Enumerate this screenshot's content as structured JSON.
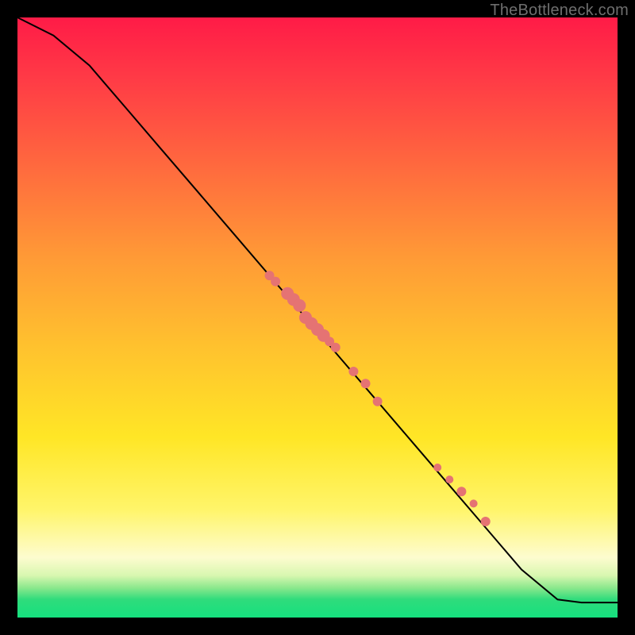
{
  "watermark": "TheBottleneck.com",
  "chart_data": {
    "type": "line",
    "title": "",
    "xlabel": "",
    "ylabel": "",
    "xlim": [
      0,
      100
    ],
    "ylim": [
      0,
      100
    ],
    "series": [
      {
        "name": "curve",
        "x": [
          0,
          6,
          12,
          18,
          24,
          30,
          36,
          42,
          48,
          54,
          60,
          66,
          72,
          78,
          84,
          90,
          94,
          100
        ],
        "y": [
          100,
          97,
          92,
          85,
          78,
          71,
          64,
          57,
          50,
          43,
          36,
          29,
          22,
          15,
          8,
          3,
          2.5,
          2.5
        ]
      }
    ],
    "points": [
      {
        "x": 42,
        "y": 57,
        "size": "md"
      },
      {
        "x": 43,
        "y": 56,
        "size": "md"
      },
      {
        "x": 45,
        "y": 54,
        "size": "lg"
      },
      {
        "x": 46,
        "y": 53,
        "size": "lg"
      },
      {
        "x": 47,
        "y": 52,
        "size": "lg"
      },
      {
        "x": 48,
        "y": 50,
        "size": "lg"
      },
      {
        "x": 49,
        "y": 49,
        "size": "lg"
      },
      {
        "x": 50,
        "y": 48,
        "size": "lg"
      },
      {
        "x": 51,
        "y": 47,
        "size": "lg"
      },
      {
        "x": 52,
        "y": 46,
        "size": "md"
      },
      {
        "x": 53,
        "y": 45,
        "size": "md"
      },
      {
        "x": 56,
        "y": 41,
        "size": "md"
      },
      {
        "x": 58,
        "y": 39,
        "size": "md"
      },
      {
        "x": 60,
        "y": 36,
        "size": "md"
      },
      {
        "x": 70,
        "y": 25,
        "size": "sm"
      },
      {
        "x": 72,
        "y": 23,
        "size": "sm"
      },
      {
        "x": 74,
        "y": 21,
        "size": "md"
      },
      {
        "x": 76,
        "y": 19,
        "size": "sm"
      },
      {
        "x": 78,
        "y": 16,
        "size": "md"
      }
    ],
    "gradient_stops": [
      {
        "pos": 0,
        "color": "#ff1b47"
      },
      {
        "pos": 25,
        "color": "#ff6a3e"
      },
      {
        "pos": 55,
        "color": "#ffc22e"
      },
      {
        "pos": 82,
        "color": "#fff56a"
      },
      {
        "pos": 95,
        "color": "#8de88d"
      },
      {
        "pos": 100,
        "color": "#15e07e"
      }
    ]
  }
}
